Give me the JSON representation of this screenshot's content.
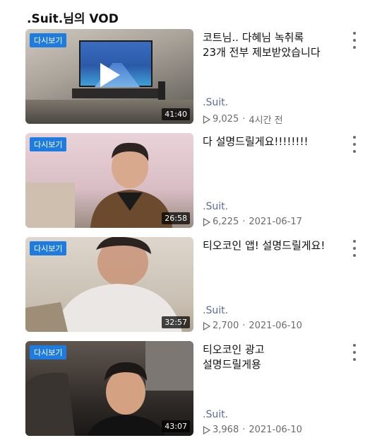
{
  "header": {
    "channel": ".Suit.",
    "suffix": "님의 VOD"
  },
  "badge_label": "다시보기",
  "colors": {
    "badge": "#1e7be0",
    "channel_text": "#5a6c9c",
    "meta_text": "#6b6b6b"
  },
  "videos": [
    {
      "title": "코트님.. 다혜님 녹취록\n23개 전부 제보받았습니다",
      "channel": ".Suit.",
      "views": "9,025",
      "date": "4시간 전",
      "duration": "41:40",
      "thumbnail_icon": "play-icon"
    },
    {
      "title": "다 설명드릴게요!!!!!!!!",
      "channel": ".Suit.",
      "views": "6,225",
      "date": "2021-06-17",
      "duration": "26:58"
    },
    {
      "title": "티오코인 앱! 설명드릴게요!",
      "channel": ".Suit.",
      "views": "2,700",
      "date": "2021-06-10",
      "duration": "32:57"
    },
    {
      "title": "티오코인 광고\n설명드릴게용",
      "channel": ".Suit.",
      "views": "3,968",
      "date": "2021-06-10",
      "duration": "43:07"
    }
  ],
  "icons": {
    "more": "more-vertical-icon",
    "views": "play-outline-icon"
  }
}
